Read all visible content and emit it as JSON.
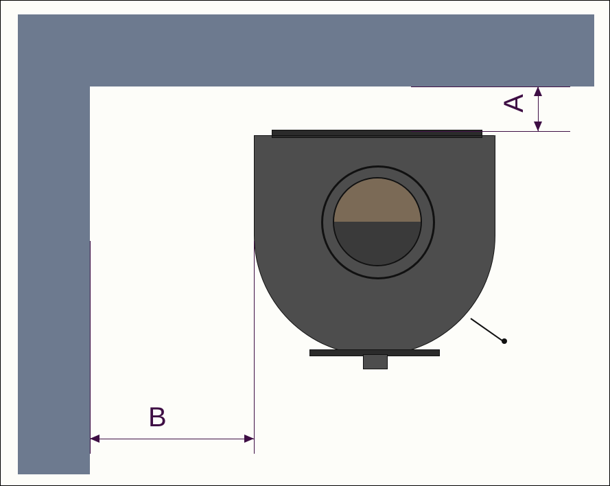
{
  "diagram": {
    "type": "installation-clearance-top-view",
    "description": "Top view of a round stove placed near an L-shaped wall corner showing required clearances.",
    "wall_color": "#6d7a8f",
    "dimension_color": "#3e0e44",
    "stove": {
      "body_color": "#4d4d4d",
      "plate_color": "#2b2b2b",
      "flue_upper_color": "#7b6a56",
      "flue_lower_color": "#3a3a3a"
    }
  },
  "dimensions": {
    "A": {
      "label": "A",
      "meaning": "Clearance from stove rear to wall behind"
    },
    "B": {
      "label": "B",
      "meaning": "Clearance from stove side to side wall"
    }
  }
}
